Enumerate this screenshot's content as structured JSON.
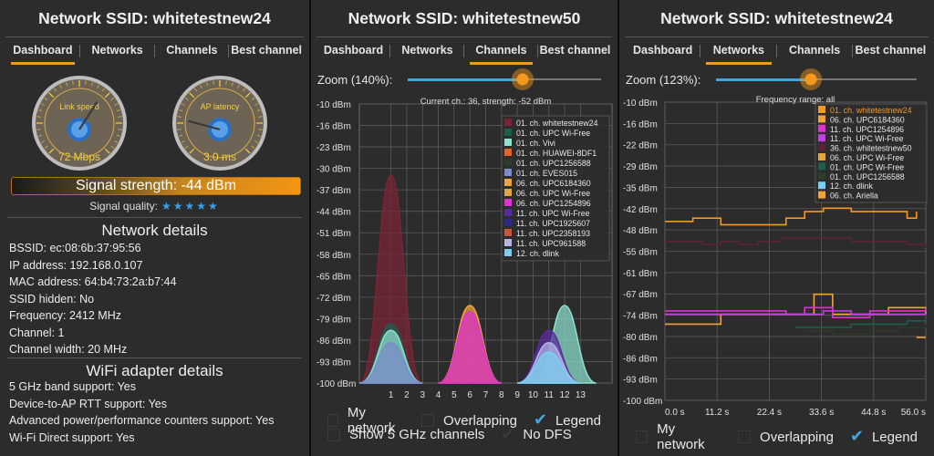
{
  "panel1": {
    "title": "Network SSID: whitetestnew24",
    "tabs": [
      "Dashboard",
      "Networks",
      "Channels",
      "Best channel"
    ],
    "active_tab": 0,
    "link_speed": {
      "label": "Link speed",
      "value": "72 Mbps",
      "reading": 72,
      "max": 1000
    },
    "ap_latency": {
      "label": "AP latency",
      "value": "3.0 ms",
      "reading": 3,
      "max": 500
    },
    "signal_strength": "Signal strength: -44 dBm",
    "signal_strength_dbm": -44,
    "signal_quality_label": "Signal quality:",
    "signal_quality_stars": "★★★★★",
    "network_details_title": "Network details",
    "network_details": [
      "BSSID: ec:08:6b:37:95:56",
      "IP address: 192.168.0.107",
      "MAC address: 64:b4:73:2a:b7:44",
      "SSID hidden: No",
      "Frequency: 2412 MHz",
      "Channel: 1",
      "Channel width: 20 MHz"
    ],
    "adapter_title": "WiFi adapter details",
    "adapter_details": [
      "5 GHz band support: Yes",
      "Device-to-AP RTT support: Yes",
      "Advanced power/performance counters support: Yes",
      "Wi-Fi Direct support: Yes"
    ]
  },
  "panel2": {
    "title": "Network SSID: whitetestnew50",
    "tabs": [
      "Dashboard",
      "Networks",
      "Channels",
      "Best channel"
    ],
    "active_tab": 2,
    "zoom_label": "Zoom (140%):",
    "zoom_percent": 140,
    "chart_header": "Current ch.: 36, strength: -52 dBm",
    "checkboxes": {
      "my_network": {
        "label": "My network",
        "checked": false
      },
      "overlapping": {
        "label": "Overlapping",
        "checked": false
      },
      "legend": {
        "label": "Legend",
        "checked": true
      },
      "show_5ghz": {
        "label": "Show 5 GHz channels",
        "checked": false
      },
      "no_dfs": {
        "label": "No DFS",
        "checked": true
      }
    },
    "chart_data": {
      "type": "area",
      "title": "Current ch.: 36, strength: -52 dBm",
      "y_ticks": [
        "-10 dBm",
        "-16 dBm",
        "-23 dBm",
        "-30 dBm",
        "-37 dBm",
        "-44 dBm",
        "-51 dBm",
        "-58 dBm",
        "-65 dBm",
        "-72 dBm",
        "-79 dBm",
        "-86 dBm",
        "-93 dBm",
        "-100 dBm"
      ],
      "x_ticks": [
        "1",
        "2",
        "3",
        "4",
        "5",
        "6",
        "7",
        "8",
        "9",
        "10",
        "11",
        "12",
        "13"
      ],
      "ylim": [
        -100,
        -10
      ],
      "xlim": [
        -1,
        15
      ],
      "legend": [
        {
          "name": "01. ch. whitetestnew24",
          "color": "#7a2436"
        },
        {
          "name": "01. ch. UPC Wi-Free",
          "color": "#1a5e4e"
        },
        {
          "name": "01. ch. Vivi",
          "color": "#8ee0cf"
        },
        {
          "name": "01. ch. HUAWEI-8DF1",
          "color": "#e8602a"
        },
        {
          "name": "01. ch. UPC1256588",
          "color": "#2e3a2a"
        },
        {
          "name": "01. ch. EVES015",
          "color": "#7a8ccc"
        },
        {
          "name": "06. ch. UPC6184360",
          "color": "#f3a23a"
        },
        {
          "name": "06. ch. UPC Wi-Free",
          "color": "#e0a640"
        },
        {
          "name": "06. ch. UPC1254896",
          "color": "#e030d0"
        },
        {
          "name": "11. ch. UPC Wi-Free",
          "color": "#5a2aa0"
        },
        {
          "name": "11. ch. UPC1925607",
          "color": "#2a2a8a"
        },
        {
          "name": "11. ch. UPC2358193",
          "color": "#c8553a"
        },
        {
          "name": "11. ch. UPC961588",
          "color": "#b6b6e8"
        },
        {
          "name": "12. ch. dlink",
          "color": "#7ad0f0"
        }
      ],
      "series": [
        {
          "name": "01. ch. whitetestnew24",
          "channel": 1,
          "dbm": -33,
          "color": "#7a2436"
        },
        {
          "name": "01. ch. UPC Wi-Free",
          "channel": 1,
          "dbm": -81,
          "color": "#1a5e4e"
        },
        {
          "name": "01. ch. Vivi",
          "channel": 1,
          "dbm": -83,
          "color": "#8ee0cf"
        },
        {
          "name": "01. ch. EVES015",
          "channel": 1,
          "dbm": -87,
          "color": "#7a8ccc"
        },
        {
          "name": "06. ch. UPC6184360",
          "channel": 6,
          "dbm": -75,
          "color": "#f3a23a"
        },
        {
          "name": "06. ch. UPC1254896",
          "channel": 6,
          "dbm": -77,
          "color": "#e030d0"
        },
        {
          "name": "12. ch. dlink",
          "channel": 12,
          "dbm": -75,
          "color": "#8ee0cf"
        },
        {
          "name": "11. ch. UPC Wi-Free",
          "channel": 11,
          "dbm": -83,
          "color": "#5a2aa0"
        },
        {
          "name": "11. ch. UPC961588",
          "channel": 11,
          "dbm": -87,
          "color": "#b6b6e8"
        },
        {
          "name": "11. ch. UPC2358193",
          "channel": 11,
          "dbm": -90,
          "color": "#7ad0f0"
        }
      ]
    }
  },
  "panel3": {
    "title": "Network SSID: whitetestnew24",
    "tabs": [
      "Dashboard",
      "Networks",
      "Channels",
      "Best channel"
    ],
    "active_tab": 1,
    "zoom_label": "Zoom (123%):",
    "zoom_percent": 123,
    "chart_header": "Frequency range: all",
    "checkboxes": {
      "my_network": {
        "label": "My network",
        "checked": false
      },
      "overlapping": {
        "label": "Overlapping",
        "checked": false
      },
      "legend": {
        "label": "Legend",
        "checked": true
      }
    },
    "chart_data": {
      "type": "line",
      "title": "Frequency range: all",
      "y_ticks": [
        "-10 dBm",
        "-16 dBm",
        "-22 dBm",
        "-29 dBm",
        "-35 dBm",
        "-42 dBm",
        "-48 dBm",
        "-55 dBm",
        "-61 dBm",
        "-67 dBm",
        "-74 dBm",
        "-80 dBm",
        "-86 dBm",
        "-93 dBm",
        "-100 dBm"
      ],
      "x_ticks": [
        "0.0 s",
        "11.2 s",
        "22.4 s",
        "33.6 s",
        "44.8 s",
        "56.0 s"
      ],
      "ylim": [
        -100,
        -10
      ],
      "xlim": [
        0,
        56
      ],
      "legend": [
        {
          "name": "01. ch. whitetestnew24",
          "color": "#f39a1c"
        },
        {
          "name": "06. ch. UPC6184360",
          "color": "#f3a23a"
        },
        {
          "name": "11. ch. UPC1254896",
          "color": "#e030d0"
        },
        {
          "name": "11. ch. UPC Wi-Free",
          "color": "#c040e0"
        },
        {
          "name": "36. ch. whitetestnew50",
          "color": "#5a2436"
        },
        {
          "name": "06. ch. UPC Wi-Free",
          "color": "#e0a640"
        },
        {
          "name": "01. ch. UPC Wi-Free",
          "color": "#1a5e4e"
        },
        {
          "name": "01. ch. UPC1256588",
          "color": "#2e3a2a"
        },
        {
          "name": "12. ch. dlink",
          "color": "#7ad0f0"
        },
        {
          "name": "06. ch. Ariella",
          "color": "#f3a23a"
        }
      ],
      "series": [
        {
          "name": "01. ch. whitetestnew24",
          "color": "#f39a1c",
          "x": [
            0,
            4,
            6,
            12,
            20,
            26,
            30,
            34,
            40,
            48,
            52,
            54
          ],
          "y": [
            -46,
            -46,
            -45,
            -47,
            -47,
            -45,
            -43,
            -42,
            -43,
            -43,
            -45,
            -43
          ]
        },
        {
          "name": "36. ch. whitetestnew50",
          "color": "#5a2436",
          "x": [
            0,
            8,
            12,
            16,
            20,
            25,
            30,
            40,
            52,
            56
          ],
          "y": [
            -52,
            -53,
            -52,
            -53,
            -52,
            -51,
            -51,
            -52,
            -53,
            -54
          ]
        },
        {
          "name": "06. ch. UPC6184360",
          "color": "#f3a23a",
          "x": [
            0,
            10,
            12,
            16,
            28,
            32,
            34,
            36,
            40,
            48,
            52,
            56
          ],
          "y": [
            -77,
            -77,
            -74,
            -74,
            -74,
            -68,
            -68,
            -74,
            -74,
            -72,
            -72,
            -74
          ]
        },
        {
          "name": "11. ch. UPC1254896",
          "color": "#e030d0",
          "x": [
            0,
            10,
            20,
            26,
            30,
            34,
            36,
            40,
            44,
            48,
            52,
            56
          ],
          "y": [
            -73,
            -73,
            -73,
            -74,
            -72,
            -72,
            -75,
            -75,
            -73,
            -73,
            -73,
            -72
          ]
        },
        {
          "name": "11. ch. UPC Wi-Free",
          "color": "#c040e0",
          "x": [
            0,
            10,
            20,
            30,
            34,
            40,
            48,
            56
          ],
          "y": [
            -74,
            -74,
            -74,
            -74,
            -73,
            -74,
            -74,
            -74
          ]
        },
        {
          "name": "01. ch. UPC Wi-Free",
          "color": "#1a5e4e",
          "x": [
            28,
            34,
            40,
            48,
            52,
            56
          ],
          "y": [
            -78,
            -78,
            -77,
            -77,
            -76,
            -75
          ]
        },
        {
          "name": "01. ch. UPC1256588",
          "color": "#2e3a2a",
          "x": [
            30,
            36,
            44,
            50,
            56
          ],
          "y": [
            -79,
            -80,
            -79,
            -78,
            -77
          ]
        },
        {
          "name": "06. ch. Ariella",
          "color": "#f3a23a",
          "x": [
            54,
            56
          ],
          "y": [
            -81,
            -81
          ]
        }
      ]
    }
  }
}
